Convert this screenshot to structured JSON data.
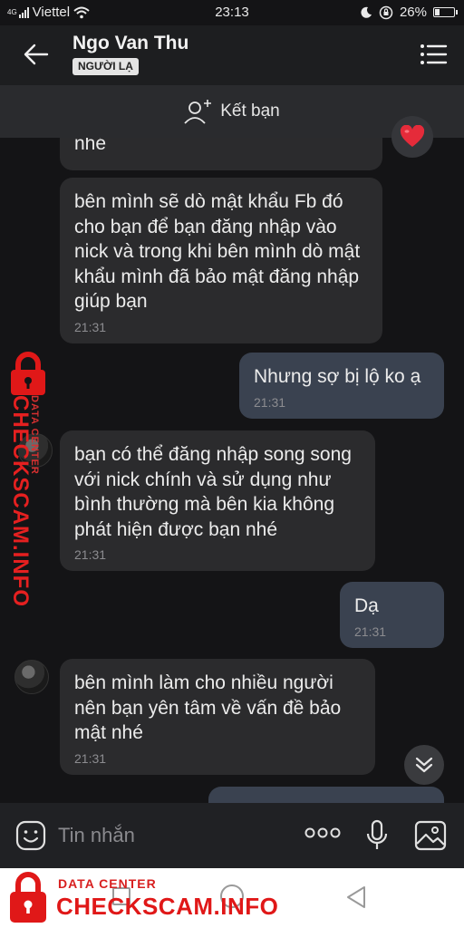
{
  "status_bar": {
    "network": "4G",
    "carrier": "Viettel",
    "time": "23:13",
    "battery": "26%",
    "battery_level": 0.26
  },
  "header": {
    "contact_name": "Ngo Van Thu",
    "badge": "NGƯỜI LẠ"
  },
  "add_friend": {
    "label": "Kết bạn"
  },
  "messages": [
    {
      "direction": "in",
      "text": "nhé",
      "time": ""
    },
    {
      "direction": "in",
      "text": "bên mình sẽ dò mật khẩu Fb đó cho bạn để bạn đăng nhập vào nick và trong khi bên mình dò mật khẩu mình đã bảo mật đăng nhập giúp bạn",
      "time": "21:31"
    },
    {
      "direction": "out",
      "text": "Nhưng sợ bị lộ ko ạ",
      "time": "21:31"
    },
    {
      "direction": "in",
      "text": "bạn có thể đăng nhập song song với nick chính và sử dụng như bình thường mà bên kia không phát hiện được bạn nhé",
      "time": "21:31"
    },
    {
      "direction": "out",
      "text": "Dạ",
      "time": "21:31"
    },
    {
      "direction": "in",
      "text": "bên mình làm cho nhiều người nên bạn yên tâm về vấn đề bảo mật nhé",
      "time": "21:31"
    }
  ],
  "input": {
    "placeholder": "Tin nhắn"
  },
  "watermark": {
    "small": "DATA CENTER",
    "big": "CHECKSCAM.INFO"
  },
  "colors": {
    "background": "#141416",
    "incoming_bubble": "#2b2b2d",
    "outgoing_bubble": "#3a4250",
    "watermark": "#e01818"
  }
}
